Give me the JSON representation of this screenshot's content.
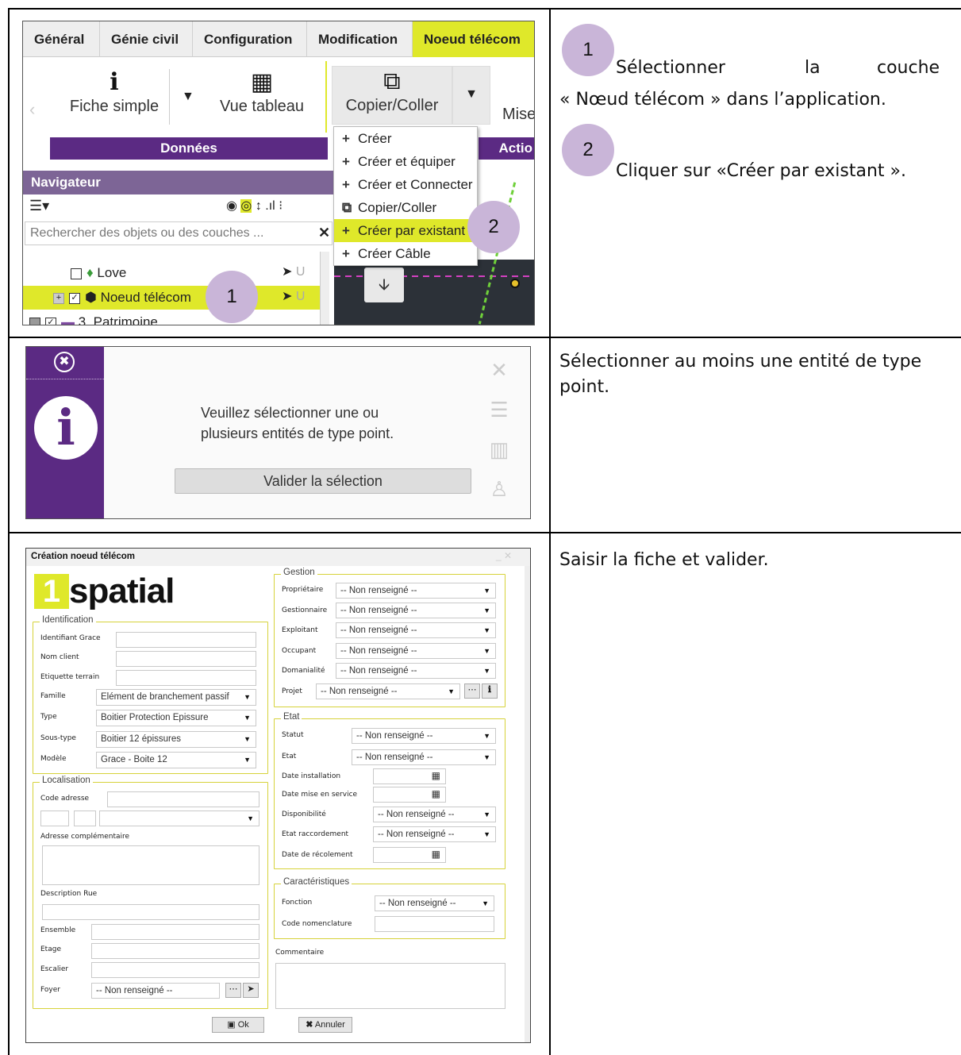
{
  "row1": {
    "tabs": [
      "Général",
      "Génie civil",
      "Configuration",
      "Modification",
      "Noeud télécom"
    ],
    "ribbon": {
      "fiche_label": "Fiche simple",
      "vue_label": "Vue tableau",
      "copier_label": "Copier/Coller",
      "mise_label": "Mise",
      "band_donnees": "Données",
      "band_actions": "Actio"
    },
    "menu_items": [
      "Créer",
      "Créer et équiper",
      "Créer et Connecter",
      "Copier/Coller",
      "Créer par existant",
      "Créer Câble"
    ],
    "navigator": {
      "title": "Navigateur",
      "search_placeholder": "Rechercher des objets ou des couches ...",
      "items": [
        "Love",
        "Noeud télécom",
        "3. Patrimoine"
      ]
    },
    "badge1": "1",
    "badge2": "2",
    "instruction1_num": "1",
    "instruction1_a": "Sélectionner",
    "instruction1_b": "la",
    "instruction1_c": "couche",
    "instruction1_line2": "« Nœud télécom » dans l’application.",
    "instruction2_num": "2",
    "instruction2_text": "Cliquer sur «Créer par existant »."
  },
  "row2": {
    "message_line1": "Veuillez sélectionner une ou",
    "message_line2": "plusieurs entités de type point.",
    "button": "Valider la sélection",
    "instruction": "Sélectionner au moins une entité de type point."
  },
  "row3": {
    "form_title": "Création noeud télécom",
    "logo_text": "spatial",
    "logo_digit": "1",
    "identification": {
      "legend": "Identification",
      "labels": [
        "Identifiant Grace",
        "Nom client",
        "Etiquette terrain",
        "Famille",
        "Type",
        "Sous-type",
        "Modèle"
      ],
      "famille": "Elément de branchement passif",
      "type": "Boitier Protection Epissure",
      "sous_type": "Boitier 12 épissures",
      "modele": "Grace - Boite 12"
    },
    "localisation": {
      "legend": "Localisation",
      "code_adresse": "Code adresse",
      "adresse_comp": "Adresse complémentaire",
      "description_rue": "Description Rue",
      "ensemble": "Ensemble",
      "etage": "Etage",
      "escalier": "Escalier",
      "foyer": "Foyer",
      "foyer_value": "-- Non renseigné --"
    },
    "gestion": {
      "legend": "Gestion",
      "labels": [
        "Propriétaire",
        "Gestionnaire",
        "Exploitant",
        "Occupant",
        "Domanialité",
        "Projet"
      ],
      "value": "-- Non renseigné --"
    },
    "etat": {
      "legend": "Etat",
      "labels": [
        "Statut",
        "Etat",
        "Date installation",
        "Date mise en service",
        "Disponibilité",
        "Etat raccordement",
        "Date de récolement"
      ],
      "value": "-- Non renseigné --"
    },
    "caracteristiques": {
      "legend": "Caractéristiques",
      "fonction": "Fonction",
      "code_nomenclature": "Code nomenclature",
      "value": "-- Non renseigné --"
    },
    "commentaire": "Commentaire",
    "ok": "Ok",
    "annuler": "Annuler",
    "instruction": "Saisir la fiche et valider."
  },
  "colors": {
    "accent_yellow": "#dfe82a",
    "purple": "#5b2a83",
    "badge": "#c9b5d8"
  }
}
